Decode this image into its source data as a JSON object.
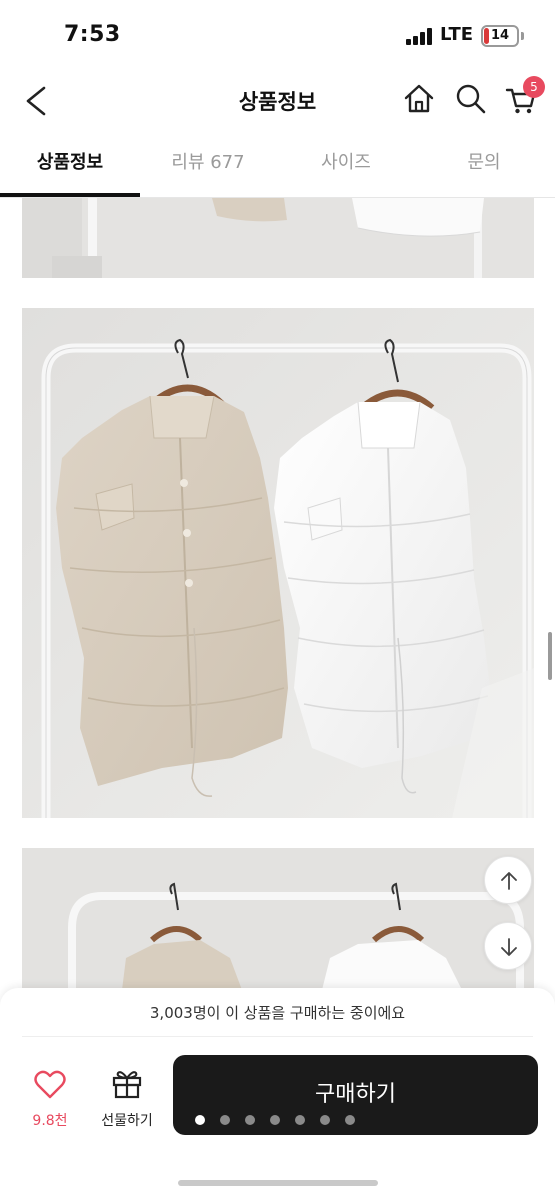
{
  "status_bar": {
    "time": "7:53",
    "network": "LTE",
    "battery_level": "14"
  },
  "header": {
    "title": "상품정보",
    "cart_count": "5",
    "icons": [
      "back-arrow-icon",
      "home-icon",
      "search-icon",
      "cart-icon"
    ]
  },
  "tabs": [
    {
      "label": "상품정보",
      "active": true
    },
    {
      "label": "리뷰 677",
      "active": false
    },
    {
      "label": "사이즈",
      "active": false
    },
    {
      "label": "문의",
      "active": false
    }
  ],
  "product_images": [
    {
      "name": "product-photo-top-cropped"
    },
    {
      "name": "product-photo-two-padded-vests"
    },
    {
      "name": "product-photo-bottom-cropped"
    }
  ],
  "floating_buttons": {
    "up_icon": "arrow-up-icon",
    "down_icon": "arrow-down-icon"
  },
  "bottom_bar": {
    "buyer_notice": "3,003명이 이 상품을 구매하는 중이에요",
    "like_count": "9.8천",
    "gift_label": "선물하기",
    "buy_label": "구매하기",
    "carousel_dots": 7,
    "active_dot": 0
  },
  "colors": {
    "accent": "#e84a5f",
    "buy_button": "#1a1a1a",
    "tab_active": "#111111",
    "tab_inactive": "#9a9a9a"
  }
}
